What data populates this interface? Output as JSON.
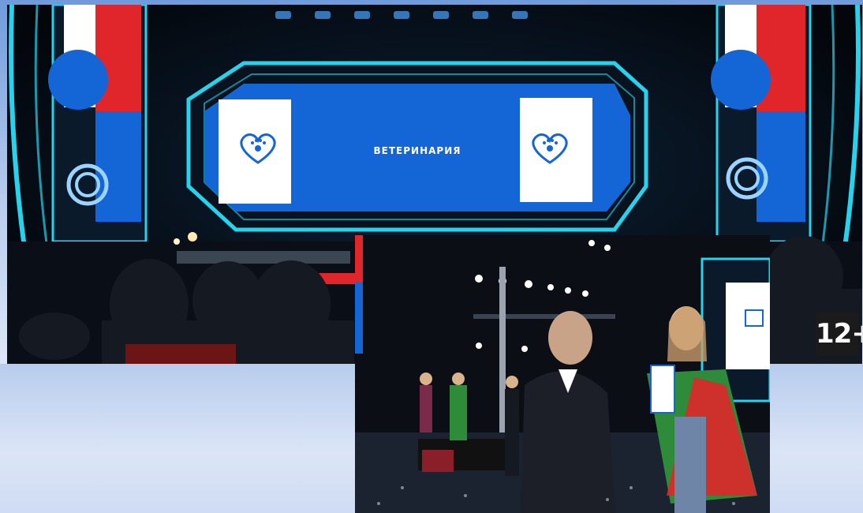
{
  "stage": {
    "screen_text": "ВЕТЕРИНАРИЯ",
    "screen_icon": "heart-paw-icon"
  },
  "age_rating": "12+",
  "colors": {
    "stage_blue": "#1466d6",
    "neon_cyan": "#27d3ec",
    "flag_red": "#e0262b",
    "flag_green": "#2e8b3a",
    "slide_background": "#c9d9f1"
  }
}
